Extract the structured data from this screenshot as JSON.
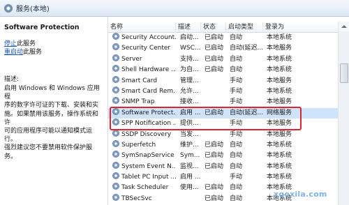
{
  "window": {
    "title": "服务(本地)",
    "icon": "services-gear-icon"
  },
  "left_pane": {
    "service_name": "Software Protection",
    "stop_link": "停止",
    "stop_suffix": "此服务",
    "restart_link": "重启动",
    "restart_suffix": "此服务",
    "description_label": "描述:",
    "description_lines": [
      "启用 Windows 和 Windows 应用程",
      "序的数字许可证的下载、安装和实",
      "施。如果禁用该服务，操作系统和许",
      "可的应用程序可能以通知模式运行。",
      "强烈建议您不要禁用软件保护服务。"
    ]
  },
  "table": {
    "columns": {
      "name": "名称",
      "description": "描述",
      "status": "状态",
      "startup": "启动类型",
      "logon": "登录为"
    },
    "rows": [
      {
        "name": "Security Account...",
        "description": "启动...",
        "status": "已启动",
        "startup": "自动",
        "logon": "本地系统",
        "selected": false
      },
      {
        "name": "Security Center",
        "description": "WSC...",
        "status": "已启动",
        "startup": "自动(延迟...",
        "logon": "本地服务",
        "selected": false
      },
      {
        "name": "Server",
        "description": "支持...",
        "status": "已启动",
        "startup": "自动",
        "logon": "本地系统",
        "selected": false
      },
      {
        "name": "Shell Hardware ...",
        "description": "为自...",
        "status": "已启动",
        "startup": "自动",
        "logon": "本地系统",
        "selected": false
      },
      {
        "name": "Smart Card",
        "description": "管理...",
        "status": "",
        "startup": "手动",
        "logon": "本地服务",
        "selected": false
      },
      {
        "name": "Smart Card Rem...",
        "description": "允许...",
        "status": "",
        "startup": "手动",
        "logon": "本地系统",
        "selected": false
      },
      {
        "name": "SNMP Trap",
        "description": "接收...",
        "status": "",
        "startup": "手动",
        "logon": "本地服务",
        "selected": false
      },
      {
        "name": "Software Protect...",
        "description": "启用 ...",
        "status": "已启动",
        "startup": "自动(延迟...",
        "logon": "网络服务",
        "selected": true
      },
      {
        "name": "SPP Notification ...",
        "description": "提供...",
        "status": "",
        "startup": "手动",
        "logon": "本地服务",
        "selected": false
      },
      {
        "name": "SSDP Discovery",
        "description": "当发...",
        "status": "",
        "startup": "手动",
        "logon": "本地服务",
        "selected": false
      },
      {
        "name": "Superfetch",
        "description": "维护...",
        "status": "已启动",
        "startup": "自动",
        "logon": "本地系统",
        "selected": false
      },
      {
        "name": "SymSnapService",
        "description": "Sym...",
        "status": "已启动",
        "startup": "自动",
        "logon": "本地系统",
        "selected": false
      },
      {
        "name": "System Event N...",
        "description": "监视...",
        "status": "已启动",
        "startup": "自动",
        "logon": "本地系统",
        "selected": false
      },
      {
        "name": "Tablet PC Input ...",
        "description": "启用 ...",
        "status": "",
        "startup": "手动",
        "logon": "本地系统",
        "selected": false
      },
      {
        "name": "Task Scheduler",
        "description": "使用...",
        "status": "已启动",
        "startup": "自动",
        "logon": "本地系统",
        "selected": false
      },
      {
        "name": "TBSecSvc",
        "description": "",
        "status": "已启动",
        "startup": "自动",
        "logon": "本地系统",
        "selected": false
      }
    ]
  },
  "watermark": "xqoxila.com",
  "colors": {
    "selected_row": "#cfe3fb",
    "highlight_box": "#e0242f",
    "link": "#1b56b8"
  }
}
